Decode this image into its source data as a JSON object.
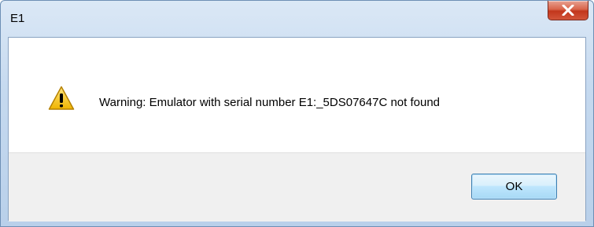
{
  "window": {
    "title": "E1"
  },
  "dialog": {
    "message": "Warning: Emulator with serial number E1:_5DS07647C not found",
    "icon": "warning-icon"
  },
  "buttons": {
    "ok_label": "OK",
    "close_icon": "close-icon"
  },
  "colors": {
    "close_button": "#c2371c",
    "ok_button_border": "#3c7fb1",
    "warning_fill": "#f5c518"
  }
}
